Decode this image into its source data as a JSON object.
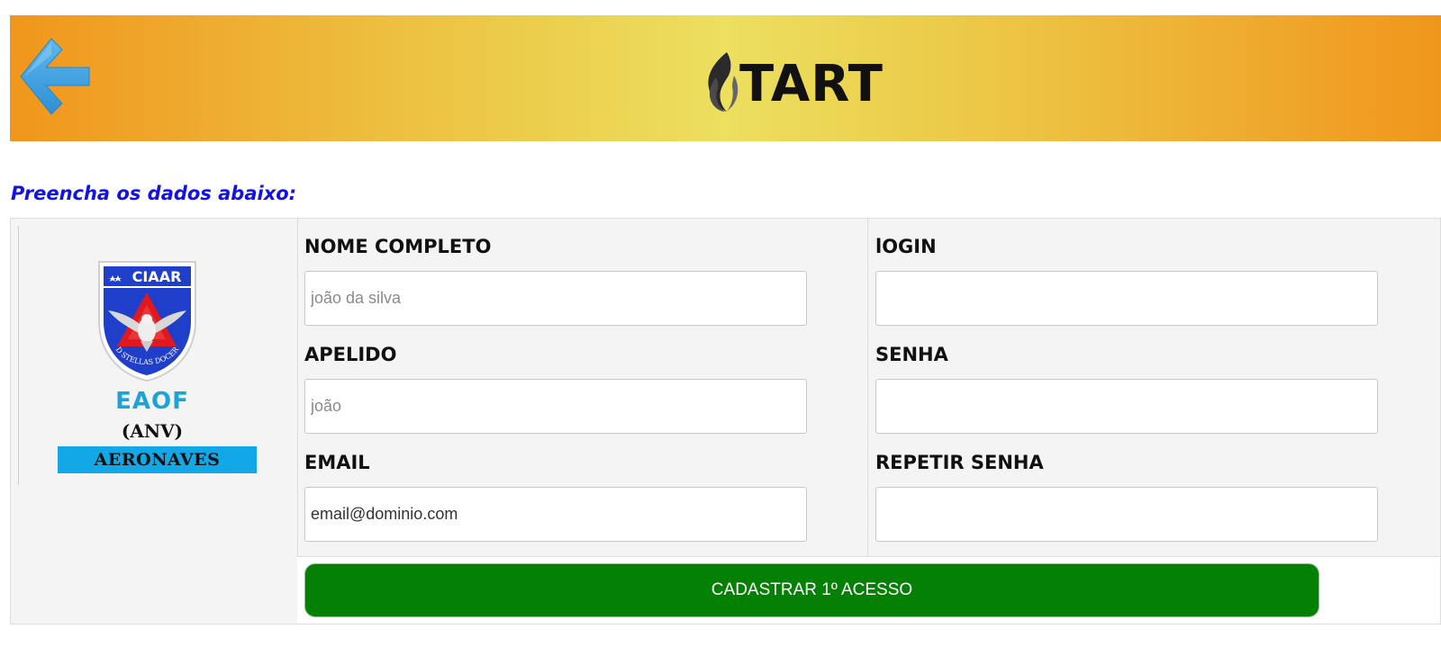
{
  "header": {
    "back_icon": "arrow-left-icon",
    "logo_icon": "flame-icon",
    "logo_text": "TART"
  },
  "instructions": "Preencha os dados abaixo:",
  "badge": {
    "crest_text": "CIAAR",
    "crest_motto": "AD STELLAS DOCERE",
    "school_code": "EAOF",
    "course_code": "(ANV)",
    "course_name": "AERONAVES"
  },
  "form": {
    "full_name": {
      "label": "NOME COMPLETO",
      "value": "",
      "placeholder": "joão da silva"
    },
    "nickname": {
      "label": "APELIDO",
      "value": "",
      "placeholder": "joão"
    },
    "email": {
      "label": "EMAIL",
      "value": "email@dominio.com",
      "placeholder": ""
    },
    "login": {
      "label": "lOGIN",
      "value": "",
      "placeholder": ""
    },
    "password": {
      "label": "SENHA",
      "value": "",
      "placeholder": ""
    },
    "repeat_password": {
      "label": "REPETIR SENHA",
      "value": "",
      "placeholder": ""
    },
    "submit_label": "CADASTRAR 1º ACESSO"
  },
  "colors": {
    "header_gradient_edge": "#f0961c",
    "header_gradient_center": "#ece05e",
    "instructions_text": "#1212e6",
    "school_code": "#1ca3d9",
    "course_band": "#12a8e8",
    "submit_button": "#048004",
    "back_arrow": "#3aa0e0"
  }
}
